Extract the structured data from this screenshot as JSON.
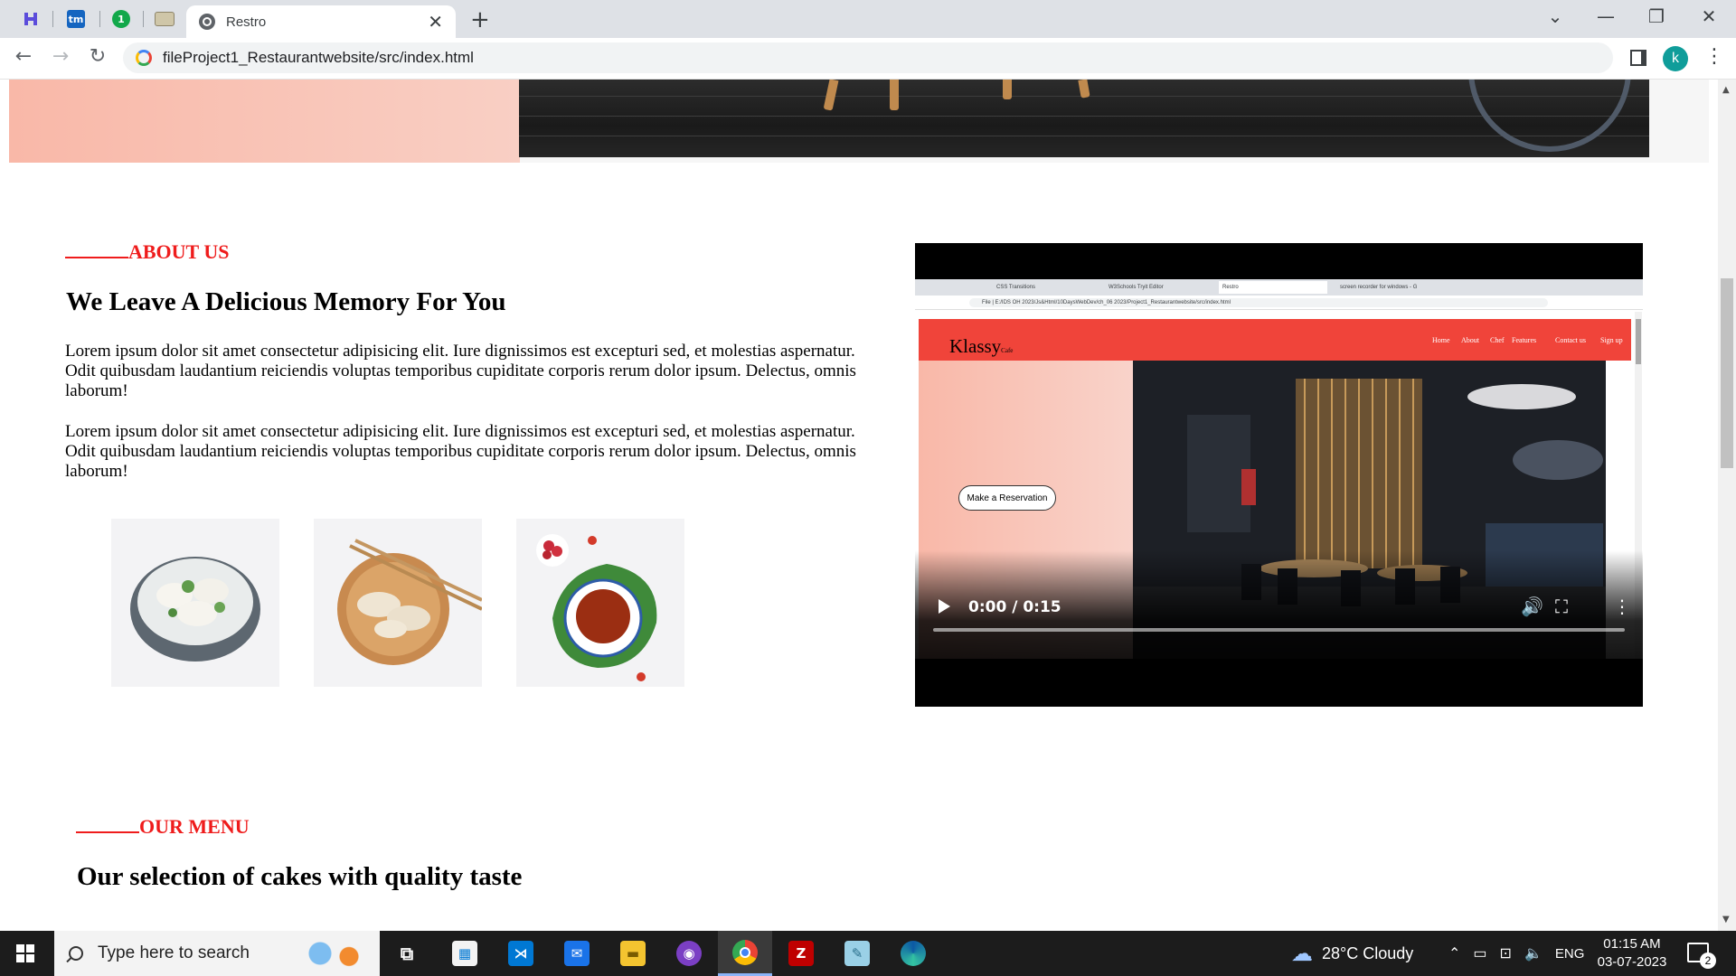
{
  "browser": {
    "pinned_tabs": [
      {
        "icon": "hackerrank-icon",
        "color": "#5b4cdb"
      },
      {
        "icon": "tm-icon",
        "label": "tm",
        "color": "#1565c0"
      },
      {
        "icon": "one-icon",
        "label": "1",
        "color": "#12a84a"
      },
      {
        "icon": "css-icon",
        "color": "#b3a98d"
      }
    ],
    "active_tab": {
      "title": "Restro"
    },
    "url": "fileProject1_Restaurantwebsite/src/index.html",
    "profile_initial": "k"
  },
  "page": {
    "about": {
      "tag": "ABOUT US",
      "heading": "We Leave A Delicious Memory For You",
      "paragraphs": [
        "Lorem ipsum dolor sit amet consectetur adipisicing elit. Iure dignissimos est excepturi sed, et molestias aspernatur. Odit quibusdam laudantium reiciendis voluptas temporibus cupiditate corporis rerum dolor ipsum. Delectus, omnis laborum!",
        "Lorem ipsum dolor sit amet consectetur adipisicing elit. Iure dignissimos est excepturi sed, et molestias aspernatur. Odit quibusdam laudantium reiciendis voluptas temporibus cupiditate corporis rerum dolor ipsum. Delectus, omnis laborum!"
      ],
      "images": [
        "dumpling-bowl-image",
        "dumplings-chopsticks-image",
        "tea-cup-image"
      ]
    },
    "video": {
      "time": "0:00 / 0:15",
      "inner": {
        "tabs": [
          "CSS Transitions",
          "W3Schools Tryit Editor",
          "Restro",
          "screen recorder for windows - G"
        ],
        "url": "File | E:/IDS OH 2023/Js&Html/10DaysWebDev/ch_06 2023/Project1_Restaurantwebsite/src/index.html",
        "brand": "Klassy",
        "brand_suffix": "Cafe",
        "menu": [
          "Home",
          "About",
          "Chef",
          "Features",
          "Contact us",
          "Sign up"
        ],
        "button": "Make a Reservation"
      }
    },
    "menu_section": {
      "tag": "OUR MENU",
      "heading": "Our selection of cakes with quality taste"
    }
  },
  "taskbar": {
    "search_placeholder": "Type here to search",
    "apps": [
      "task-view-icon",
      "microsoft-store-icon",
      "vscode-icon",
      "mail-icon",
      "file-explorer-icon",
      "github-desktop-icon",
      "chrome-icon",
      "filezilla-icon",
      "notepad-icon",
      "edge-icon"
    ],
    "weather": "28°C  Cloudy",
    "language": "ENG",
    "time": "01:15 AM",
    "date": "03-07-2023",
    "notifications": "2"
  },
  "colors": {
    "accent_red": "#ef1c1c",
    "salmon": "#f9b8a8",
    "nav_red": "#f0443a"
  }
}
